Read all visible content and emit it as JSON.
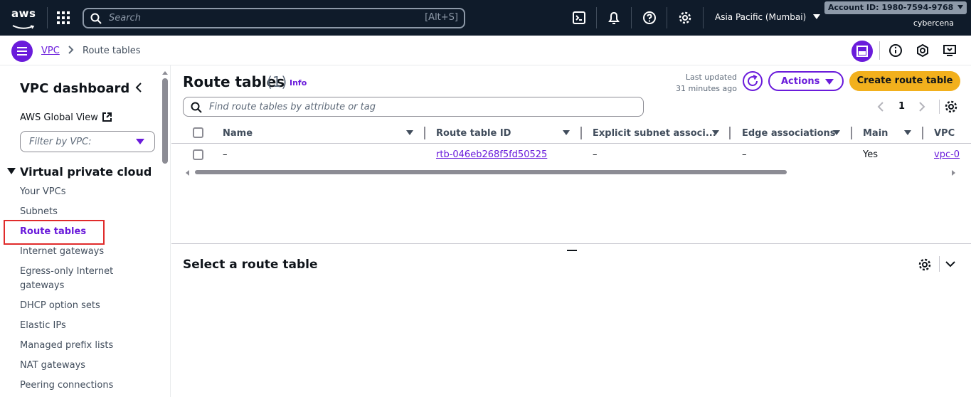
{
  "topbar": {
    "logo_text": "aws",
    "search_placeholder": "Search",
    "search_shortcut": "[Alt+S]",
    "region": "Asia Pacific (Mumbai)",
    "account": "Account ID: 1980-7594-9768",
    "user": "cybercena",
    "icons": [
      "grid-icon",
      "search-icon",
      "cloudshell-icon",
      "bell-icon",
      "help-icon",
      "settings-icon"
    ]
  },
  "breadcrumb": {
    "root": "VPC",
    "current": "Route tables"
  },
  "sidebar": {
    "title": "VPC dashboard",
    "global_view": "AWS Global View",
    "filter_placeholder": "Filter by VPC:",
    "section": "Virtual private cloud",
    "items": [
      {
        "label": "Your VPCs"
      },
      {
        "label": "Subnets"
      },
      {
        "label": "Route tables"
      },
      {
        "label": "Internet gateways"
      },
      {
        "label": "Egress-only Internet gateways"
      },
      {
        "label": "DHCP option sets"
      },
      {
        "label": "Elastic IPs"
      },
      {
        "label": "Managed prefix lists"
      },
      {
        "label": "NAT gateways"
      },
      {
        "label": "Peering connections"
      }
    ],
    "active_item": "Route tables"
  },
  "main": {
    "title": "Route tables",
    "count": "(1)",
    "info": "Info",
    "last_updated_label": "Last updated",
    "last_updated_value": "31 minutes ago",
    "actions_label": "Actions",
    "create_label": "Create route table",
    "filter_placeholder": "Find route tables by attribute or tag",
    "page_number": "1",
    "columns": [
      "Name",
      "Route table ID",
      "Explicit subnet associ...",
      "Edge associations",
      "Main",
      "VPC"
    ],
    "rows": [
      {
        "name": "–",
        "route_table_id": "rtb-046eb268f5fd50525",
        "explicit_subnet": "–",
        "edge": "–",
        "main": "Yes",
        "vpc": "vpc-0"
      }
    ],
    "detail_title": "Select a route table"
  },
  "colors": {
    "accent": "#6a1bdb",
    "topbar_bg": "#0f1b2a",
    "primary_button": "#f2b01d",
    "highlight_box": "#e02b2b"
  }
}
